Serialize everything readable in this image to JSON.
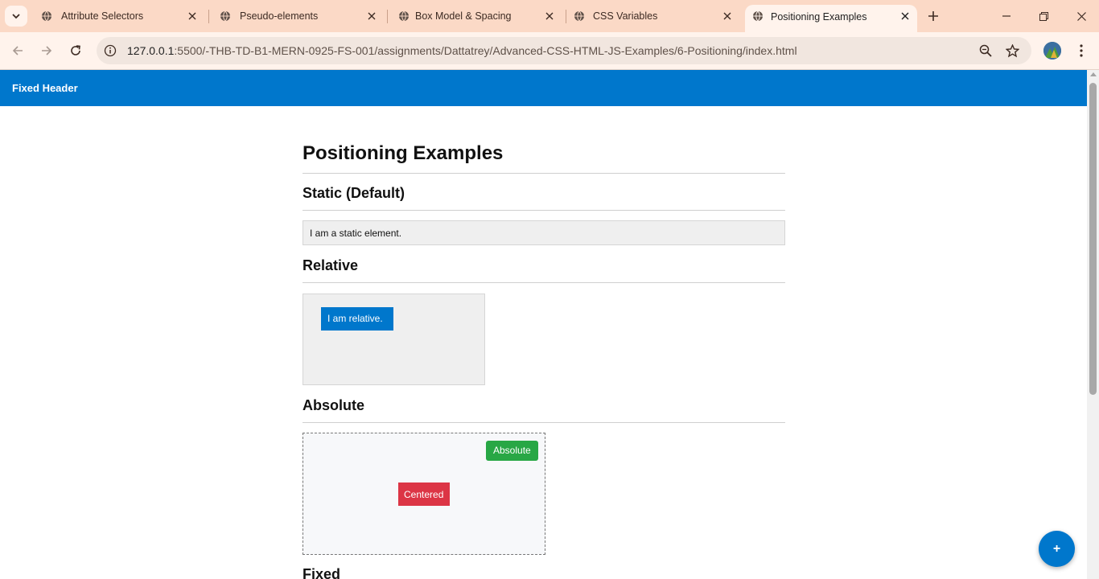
{
  "browser": {
    "tabs": [
      {
        "title": "Attribute Selectors",
        "active": false
      },
      {
        "title": "Pseudo-elements",
        "active": false
      },
      {
        "title": "Box Model & Spacing",
        "active": false
      },
      {
        "title": "CSS Variables",
        "active": false
      },
      {
        "title": "Positioning Examples",
        "active": true
      }
    ],
    "new_tab_label": "+",
    "url_host": "127.0.0.1",
    "url_path": ":5500/-THB-TD-B1-MERN-0925-FS-001/assignments/Dattatrey/Advanced-CSS-HTML-JS-Examples/6-Positioning/index.html",
    "colors": {
      "tabstrip": "#fbd9c6",
      "toolbar": "#fff3ec"
    }
  },
  "page": {
    "fixed_header": "Fixed Header",
    "title": "Positioning Examples",
    "sections": {
      "static": {
        "heading": "Static (Default)",
        "box_text": "I am a static element."
      },
      "relative": {
        "heading": "Relative",
        "chip_text": "I am relative."
      },
      "absolute": {
        "heading": "Absolute",
        "corner_chip": "Absolute",
        "center_chip": "Centered"
      },
      "fixed": {
        "heading": "Fixed"
      }
    },
    "fab_label": "+",
    "colors": {
      "primary": "#0077cc",
      "success": "#28a745",
      "danger": "#dc3545"
    }
  }
}
